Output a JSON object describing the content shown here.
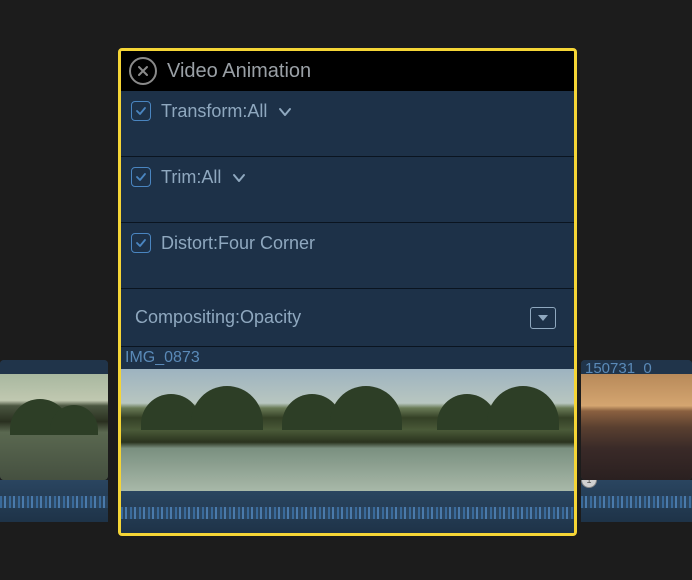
{
  "panel": {
    "title": "Video Animation",
    "rows": [
      {
        "label": "Transform:All",
        "hasCheckbox": true,
        "hasChevron": true
      },
      {
        "label": "Trim:All",
        "hasCheckbox": true,
        "hasChevron": true
      },
      {
        "label": "Distort:Four Corner",
        "hasCheckbox": true,
        "hasChevron": false
      },
      {
        "label": "Compositing:Opacity",
        "hasCheckbox": false,
        "hasExpand": true
      }
    ],
    "clipLabel": "IMG_0873"
  },
  "timeline": {
    "rightClipLabel": "150731_0",
    "marker": "1"
  }
}
